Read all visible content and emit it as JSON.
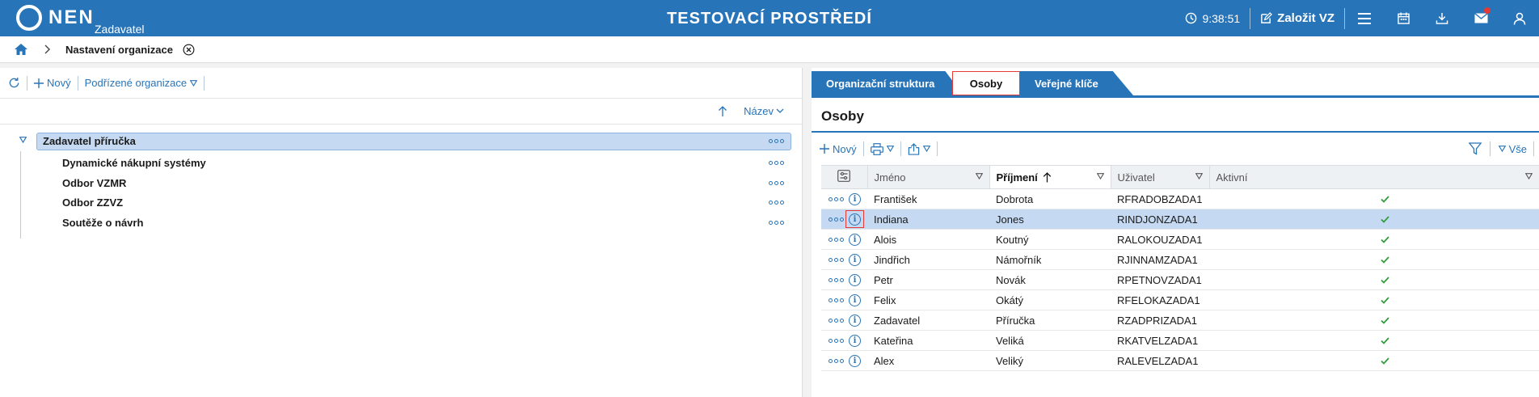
{
  "header": {
    "logo_text": "NEN",
    "logo_sub": "Zadavatel",
    "env_title": "TESTOVACÍ PROSTŘEDÍ",
    "time": "9:38:51",
    "create_label": "Založit VZ"
  },
  "breadcrumb": {
    "current": "Nastavení organizace"
  },
  "left": {
    "toolbar": {
      "new_label": "Nový",
      "sub_orgs_label": "Podřízené organizace"
    },
    "sort": {
      "field_label": "Název"
    },
    "tree": {
      "root": "Zadavatel příručka",
      "children": [
        "Dynamické nákupní systémy",
        "Odbor VZMR",
        "Odbor ZZVZ",
        "Soutěže o návrh"
      ]
    }
  },
  "right": {
    "tabs": [
      "Organizační struktura",
      "Osoby",
      "Veřejné klíče"
    ],
    "active_tab": "Osoby",
    "title": "Osoby",
    "toolbar": {
      "new_label": "Nový",
      "filter_all_label": "Vše"
    },
    "columns": [
      "Jméno",
      "Příjmení",
      "Uživatel",
      "Aktivní"
    ],
    "sorted_column": "Příjmení",
    "rows": [
      {
        "first": "František",
        "last": "Dobrota",
        "user": "RFRADOBZADA1",
        "active": true
      },
      {
        "first": "Indiana",
        "last": "Jones",
        "user": "RINDJONZADA1",
        "active": true,
        "selected": true
      },
      {
        "first": "Alois",
        "last": "Koutný",
        "user": "RALOKOUZADA1",
        "active": true
      },
      {
        "first": "Jindřich",
        "last": "Námořník",
        "user": "RJINNAMZADA1",
        "active": true
      },
      {
        "first": "Petr",
        "last": "Novák",
        "user": "RPETNOVZADA1",
        "active": true
      },
      {
        "first": "Felix",
        "last": "Okátý",
        "user": "RFELOKAZADA1",
        "active": true
      },
      {
        "first": "Zadavatel",
        "last": "Příručka",
        "user": "RZADPRIZADA1",
        "active": true
      },
      {
        "first": "Kateřina",
        "last": "Veliká",
        "user": "RKATVELZADA1",
        "active": true
      },
      {
        "first": "Alex",
        "last": "Veliký",
        "user": "RALEVELZADA1",
        "active": true
      }
    ]
  },
  "colors": {
    "brand": "#2874b8",
    "selection": "#c5daf2",
    "check": "#2e9e3a",
    "highlight": "#e53935"
  },
  "icons": [
    "clock-icon",
    "edit-icon",
    "menu-icon",
    "calendar-icon",
    "download-icon",
    "mail-icon",
    "user-icon",
    "home-icon",
    "refresh-icon",
    "print-icon",
    "export-icon",
    "filter-icon",
    "info-icon",
    "check-icon"
  ]
}
